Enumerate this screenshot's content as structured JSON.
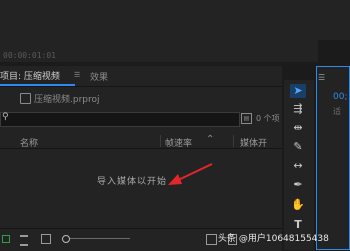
{
  "source_monitor": {
    "timecode": "00:00:01:01"
  },
  "project_panel": {
    "tab_project_label": "项目: 压缩视频",
    "tab_effects_label": "效果",
    "menu_icon": "hamburger-icon",
    "project_file": "压缩视频.prproj",
    "search_placeholder": "",
    "item_count": "0 个项",
    "columns": {
      "name": "名称",
      "fps": "帧速率",
      "media_start": "媒体开"
    },
    "empty_message": "导入媒体以开始"
  },
  "program_monitor": {
    "timecode": "00;",
    "label": "适"
  },
  "tools": [
    "selection-tool",
    "track-select-tool",
    "ripple-edit-tool",
    "razor-tool",
    "slip-tool",
    "pen-tool",
    "hand-tool",
    "type-tool"
  ],
  "annotation": {
    "arrow_color": "#e5252a"
  },
  "watermark": "头条 @用户10648155438",
  "colors": {
    "accent": "#2d8ceb",
    "panel": "#232323",
    "background": "#1b1b1b"
  }
}
